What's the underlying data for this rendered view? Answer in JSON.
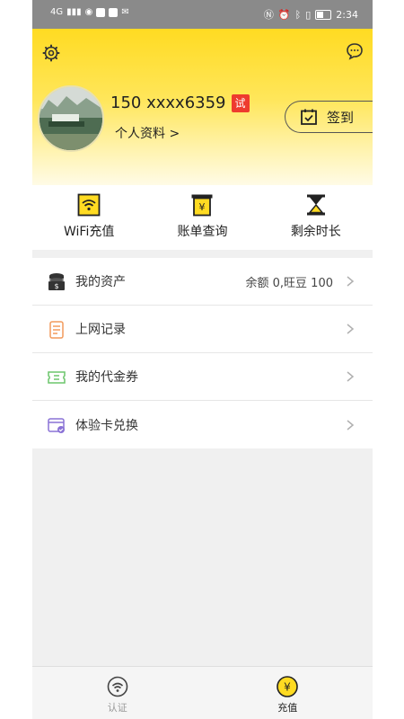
{
  "status_bar": {
    "network": "4G",
    "time": "2:34"
  },
  "header": {
    "phone": "150 xxxx6359",
    "trial_badge": "试",
    "profile_link": "个人资料 >",
    "signin_label": "签到"
  },
  "actions": [
    {
      "label": "WiFi充值",
      "icon": "wifi-card-icon"
    },
    {
      "label": "账单查询",
      "icon": "bill-icon"
    },
    {
      "label": "剩余时长",
      "icon": "hourglass-icon"
    }
  ],
  "menu": [
    {
      "label": "我的资产",
      "value": "余额 0,旺豆 100",
      "icon": "coins-icon"
    },
    {
      "label": "上网记录",
      "value": "",
      "icon": "record-icon"
    },
    {
      "label": "我的代金券",
      "value": "",
      "icon": "voucher-icon"
    },
    {
      "label": "体验卡兑换",
      "value": "",
      "icon": "card-exchange-icon"
    }
  ],
  "bottom_nav": [
    {
      "label": "认证",
      "icon": "wifi-icon",
      "active": false
    },
    {
      "label": "充值",
      "icon": "yuan-icon",
      "active": true
    }
  ],
  "colors": {
    "brand_yellow": "#ffdb22",
    "badge_red": "#ee3b2e"
  }
}
